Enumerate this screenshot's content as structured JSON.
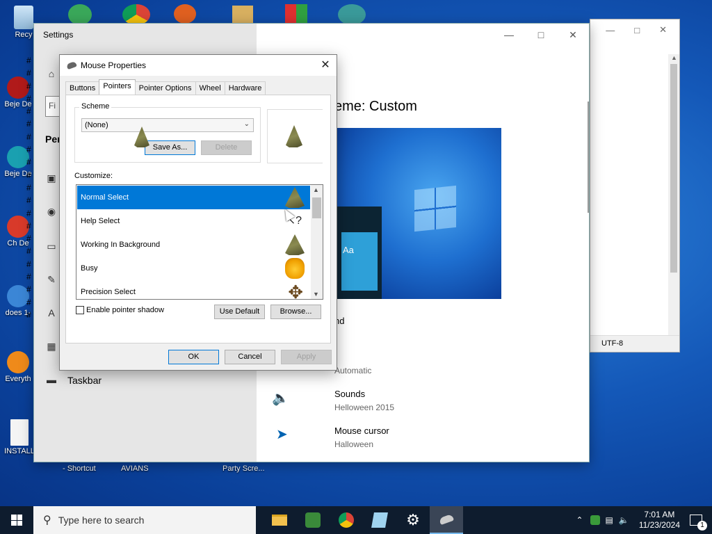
{
  "desktop": {
    "icons": [
      {
        "label": "Recy"
      },
      {
        "label": "Beje De"
      },
      {
        "label": "Beje De"
      },
      {
        "label": "Ch De"
      },
      {
        "label": "does 1-"
      },
      {
        "label": "Everyth"
      },
      {
        "label": "INSTALL"
      }
    ],
    "bottom_labels": [
      "- Shortcut",
      "AVIANS",
      "Party Scre..."
    ]
  },
  "notepad": {
    "status_encoding": "UTF-8"
  },
  "settings": {
    "title": "Settings",
    "search_placeholder": "Fi",
    "section_short": "Per",
    "taskbar_item": "Taskbar",
    "heading": "eme: Custom",
    "preview_text": "Aa",
    "background_partial": "nd",
    "color_partial": "Automatic",
    "sounds": {
      "label": "Sounds",
      "value": "Helloween 2015"
    },
    "mouse_cursor": {
      "label": "Mouse cursor",
      "value": "Halloween"
    },
    "hash_markers": "#"
  },
  "dialog": {
    "title": "Mouse Properties",
    "tabs": [
      "Buttons",
      "Pointers",
      "Pointer Options",
      "Wheel",
      "Hardware"
    ],
    "active_tab": "Pointers",
    "scheme_label": "Scheme",
    "scheme_value": "(None)",
    "save_as": "Save As...",
    "delete": "Delete",
    "customize_label": "Customize:",
    "rows": [
      {
        "label": "Normal Select",
        "selected": true
      },
      {
        "label": "Help Select",
        "selected": false
      },
      {
        "label": "Working In Background",
        "selected": false
      },
      {
        "label": "Busy",
        "selected": false
      },
      {
        "label": "Precision Select",
        "selected": false
      }
    ],
    "shadow_label": "Enable pointer shadow",
    "use_default": "Use Default",
    "browse": "Browse...",
    "ok": "OK",
    "cancel": "Cancel",
    "apply": "Apply"
  },
  "taskbar": {
    "search_placeholder": "Type here to search",
    "time": "7:01 AM",
    "date": "11/23/2024",
    "notification_count": "1"
  },
  "colors": {
    "accent": "#0078d7",
    "taskbar": "#0e1c2e",
    "desktop": "#1458b8"
  }
}
